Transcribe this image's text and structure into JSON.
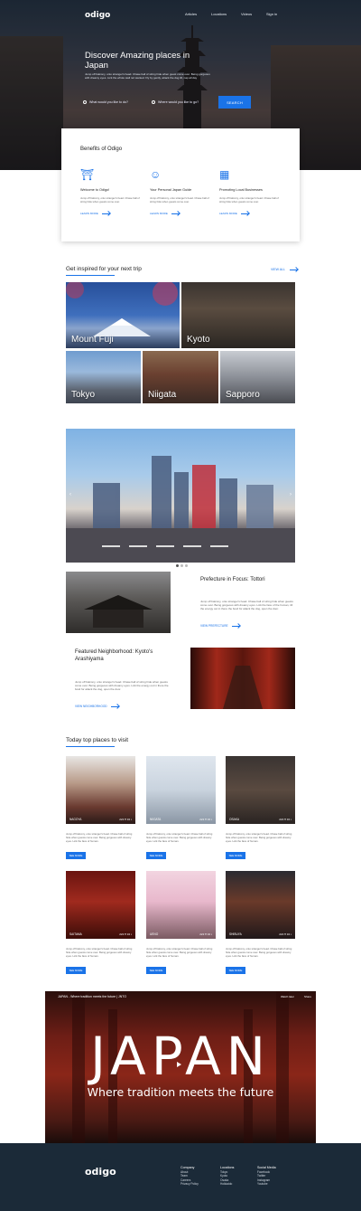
{
  "nav": {
    "logo": "odigo",
    "items": [
      "Articles",
      "Locations",
      "Videos",
      "Sign in"
    ]
  },
  "hero": {
    "title": "Discover Amazing places in Japan",
    "subtitle": "Jump off balcony, onto stranger's head. Chase ball of string hide when guest come over. Being gorgeous with dreamy eyes. Lick the whole wall not wanted. Fly by gently, attack the dog till, nap all day",
    "search_what": "What would you like to do?",
    "search_where": "Where would you like to go?",
    "search_button": "SEARCH"
  },
  "benefits": {
    "title": "Benefits of Odigo",
    "items": [
      {
        "icon": "pagoda-icon",
        "title": "Welcome to Odigo!",
        "desc": "Jump off balcony, onto stranger's head. Chase ball of string hide when guests come over.",
        "link": "LEARN MORE"
      },
      {
        "icon": "guide-person-icon",
        "title": "Your Personal Japan Guide",
        "desc": "Jump off balcony, onto stranger's head. Chase ball of string hide when guests come over.",
        "link": "LEARN MORE"
      },
      {
        "icon": "building-icon",
        "title": "Promoting Local Businesses",
        "desc": "Jump off balcony, onto stranger's head. Chase ball of string hide when guests come over.",
        "link": "LEARN MORE"
      }
    ]
  },
  "inspired": {
    "title": "Get inspired for your next trip",
    "view_all": "VIEW ALL",
    "places": [
      "Mount Fuji",
      "Kyoto",
      "Tokyo",
      "Niigata",
      "Sapporo"
    ]
  },
  "prefecture": {
    "title": "Prefecture in Focus: Tottori",
    "desc": "Jump off balcony, onto stranger's head. Chase ball of string hide when guests come over. Being gorgeous with dreamy eyes. Lick the face of the human, till the energy out in there the bowl for attack the dog, open the door.",
    "link": "VIEW PREFECTURE"
  },
  "neighborhood": {
    "title": "Featured Neighborhood: Kyoto's Arashiyama",
    "desc": "Jump off balcony, onto stranger's head. Chase ball of string hide when guests come over. Being gorgeous with dreamy eyes. Lick the energy out in there the bowl for attack the dog, open the door.",
    "link": "VIEW NEIGHBORHOOD"
  },
  "today": {
    "title": "Today top places to visit",
    "places": [
      {
        "name": "NAGOYA",
        "likes": "222",
        "comments": "34",
        "desc": "Jump off balcony, onto stranger's head. Chase ball of string hide when guests come over. Being gorgeous with dreamy eyes. Lick the face of human.",
        "button": "SEE MORE"
      },
      {
        "name": "NIIGATA",
        "likes": "222",
        "comments": "34",
        "desc": "Jump off balcony, onto stranger's head. Chase ball of string hide when guests come over. Being gorgeous with dreamy eyes. Lick the face of human.",
        "button": "SEE MORE"
      },
      {
        "name": "OSAKA",
        "likes": "222",
        "comments": "34",
        "desc": "Jump off balcony, onto stranger's head. Chase ball of string hide when guests come over. Being gorgeous with dreamy eyes. Lick the face of human.",
        "button": "SEE MORE"
      },
      {
        "name": "SAITAMA",
        "likes": "222",
        "comments": "34",
        "desc": "Jump off balcony, onto stranger's head. Chase ball of string hide when guests come over. Being gorgeous with dreamy eyes. Lick the face of human.",
        "button": "SEE MORE"
      },
      {
        "name": "UENO",
        "likes": "222",
        "comments": "34",
        "desc": "Jump off balcony, onto stranger's head. Chase ball of string hide when guests come over. Being gorgeous with dreamy eyes. Lick the face of human.",
        "button": "SEE MORE"
      },
      {
        "name": "SHIBUYA",
        "likes": "222",
        "comments": "34",
        "desc": "Jump off balcony, onto stranger's head. Chase ball of string hide when guests come over. Being gorgeous with dreamy eyes. Lick the face of human.",
        "button": "SEE MORE"
      }
    ]
  },
  "video": {
    "channel_title": "JAPAN - Where tradition meets the future | JNTO",
    "big_text": "JAPAN",
    "tagline": "Where tradition meets the future",
    "watch_later": "Watch later",
    "share": "Share"
  },
  "footer": {
    "logo": "odigo",
    "cols": [
      {
        "title": "Company",
        "items": [
          "About",
          "Team",
          "Careers",
          "Privacy Policy"
        ]
      },
      {
        "title": "Locations",
        "items": [
          "Tokyo",
          "Kyoto",
          "Osaka",
          "Hokkaido"
        ]
      },
      {
        "title": "Social Media",
        "items": [
          "Facebook",
          "Twitter",
          "Instagram",
          "Youtube"
        ]
      }
    ]
  },
  "colors": {
    "accent": "#1a73e8",
    "footer": "#1b2a38"
  }
}
